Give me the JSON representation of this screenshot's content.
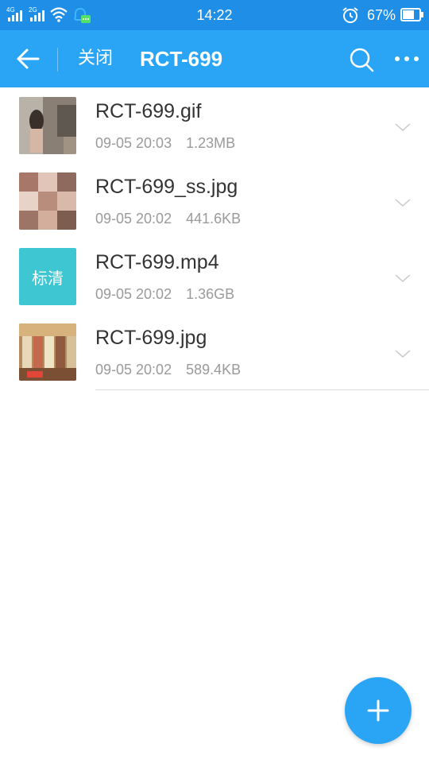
{
  "status_bar": {
    "network1": "4G",
    "network2": "2G",
    "time": "14:22",
    "battery_percent": "67%"
  },
  "app_bar": {
    "close_label": "关闭",
    "title": "RCT-699"
  },
  "files": [
    {
      "name": "RCT-699.gif",
      "date": "09-05 20:03",
      "size": "1.23MB",
      "thumb": "image"
    },
    {
      "name": "RCT-699_ss.jpg",
      "date": "09-05 20:02",
      "size": "441.6KB",
      "thumb": "image"
    },
    {
      "name": "RCT-699.mp4",
      "date": "09-05 20:02",
      "size": "1.36GB",
      "thumb": "video",
      "thumb_label": "标清"
    },
    {
      "name": "RCT-699.jpg",
      "date": "09-05 20:02",
      "size": "589.4KB",
      "thumb": "image"
    }
  ],
  "colors": {
    "status_bar": "#1e8ee6",
    "app_bar": "#2aa5f6",
    "video_thumb": "#3ec7d2",
    "fab": "#2aa5f6"
  }
}
